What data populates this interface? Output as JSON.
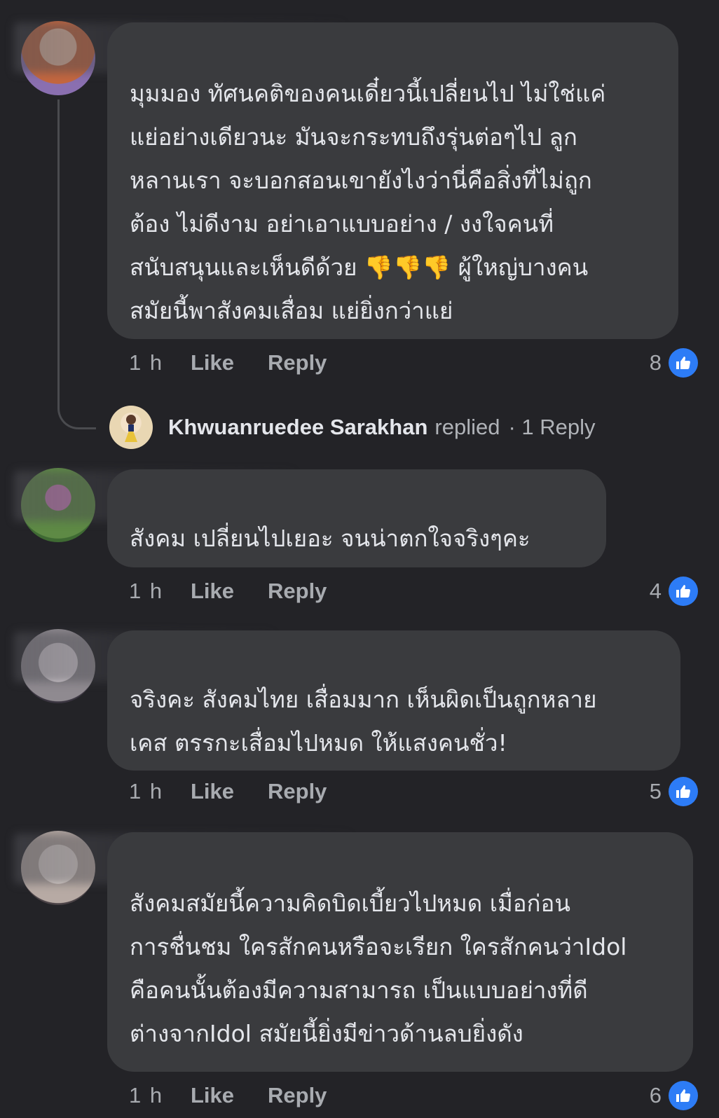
{
  "comments": [
    {
      "lines": [
        "มุมมอง ทัศนคติของคนเดี๋ยวนี้เปลี่ยนไป ไม่ใช่แค่",
        "แย่อย่างเดียวนะ มันจะกระทบถึงรุ่นต่อๆไป ลูก",
        "หลานเรา  จะบอกสอนเขายังไงว่านี่คือสิ่งที่ไม่ถูก",
        "ต้อง ไม่ดีงาม  อย่าเอาแบบอย่าง / งงใจคนที่",
        "สนับสนุนและเห็นดีด้วย 👎👎👎 ผู้ใหญ่บางคน",
        "สมัยนี้พาสังคมเสื่อม แย่ยิ่งกว่าแย่"
      ],
      "time": "1 h",
      "like_label": "Like",
      "reply_label": "Reply",
      "reaction_count": "8"
    },
    {
      "lines": [
        "สังคม เปลี่ยนไปเยอะ จนน่าตกใจจริงๆคะ"
      ],
      "time": "1 h",
      "like_label": "Like",
      "reply_label": "Reply",
      "reaction_count": "4"
    },
    {
      "lines": [
        "จริงคะ สังคมไทย เสื่อมมาก เห็นผิดเป็นถูกหลาย",
        "เคส ตรรกะเสื่อมไปหมด ให้แสงคนชั่ว!"
      ],
      "time": "1 h",
      "like_label": "Like",
      "reply_label": "Reply",
      "reaction_count": "5"
    },
    {
      "lines": [
        "สังคมสมัยนี้ความคิดบิดเบี้ยวไปหมด เมื่อก่อน",
        "การชื่นชม ใครสักคนหรือจะเรียก ใครสักคนว่าIdol",
        "คือคนนั้นต้องมีความสามารถ เป็นแบบอย่างที่ดี",
        "ต่างจากIdol สมัยนี้ยิ่งมีข่าวด้านลบยิ่งดัง"
      ],
      "time": "1 h",
      "like_label": "Like",
      "reply_label": "Reply",
      "reaction_count": "6"
    }
  ],
  "reply_summary": {
    "name": "Khwuanruedee Sarakhan",
    "action": "replied",
    "count_text": "· 1 Reply"
  },
  "colors": {
    "background": "#232327",
    "bubble": "#3a3b3e",
    "like_badge": "#2d7cf6"
  },
  "icons": [
    "like-icon",
    "thumbs-down-emoji"
  ]
}
